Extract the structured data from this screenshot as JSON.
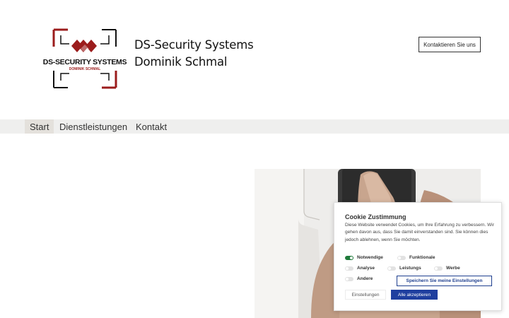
{
  "brand": {
    "logo_text": "DS-SECURITY SYSTEMS",
    "logo_subtext": "DOMINIK SCHMAL",
    "name_line1": "DS-Security Systems",
    "name_line2": "Dominik Schmal"
  },
  "header": {
    "contact_button": "Kontaktieren Sie uns"
  },
  "nav": {
    "items": [
      {
        "label": "Start",
        "active": true
      },
      {
        "label": "Dienstleistungen",
        "active": false
      },
      {
        "label": "Kontakt",
        "active": false
      }
    ]
  },
  "cookie": {
    "title": "Cookie Zustimmung",
    "text": "Diese Website verwendet Cookies, um Ihre Erfahrung zu verbessern. Wir gehen davon aus, dass Sie damit einverstanden sind. Sie können dies jedoch ablehnen, wenn Sie möchten.",
    "options": [
      {
        "label": "Notwendige",
        "on": true
      },
      {
        "label": "Funktionale",
        "on": false
      },
      {
        "label": "Analyse",
        "on": false
      },
      {
        "label": "Leistungs",
        "on": false
      },
      {
        "label": "Werbe",
        "on": false
      },
      {
        "label": "Andere",
        "on": false
      }
    ],
    "save_button": "Speichern Sie meine Einstellungen",
    "settings_button": "Einstellungen",
    "accept_button": "Alle akzeptieren"
  },
  "colors": {
    "logo_red": "#9b1c1c",
    "logo_dark": "#111111",
    "nav_bg": "#efefee",
    "toggle_on": "#1f7a3a",
    "button_blue": "#1f3f9f"
  },
  "icons": {
    "logo": "ds-security-logo",
    "hero": "fingerprint-scanner-photo"
  }
}
